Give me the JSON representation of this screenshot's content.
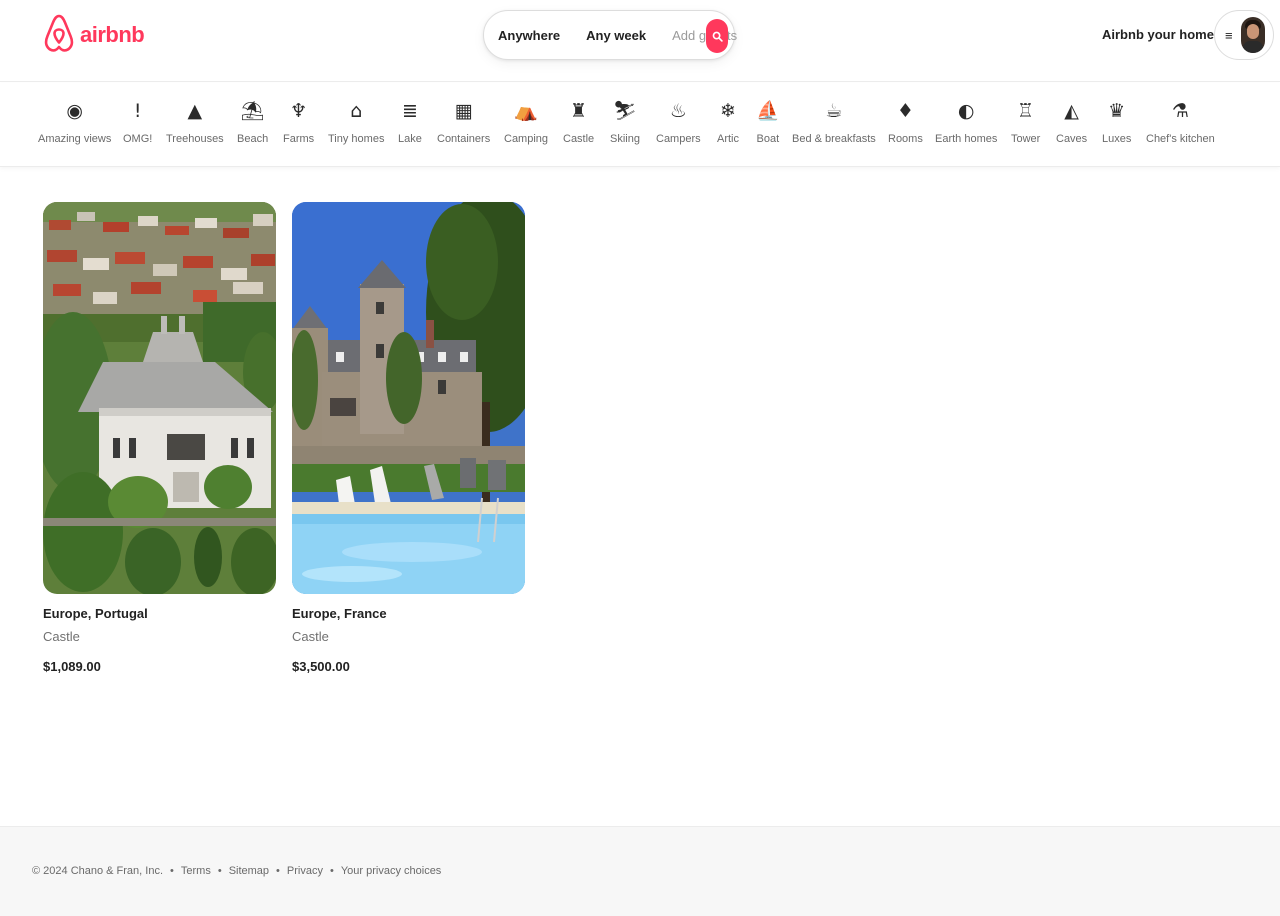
{
  "brand": {
    "name": "airbnb",
    "color": "#ff385c",
    "logo_icon": "airbnb-belo-icon"
  },
  "search": {
    "where": "Anywhere",
    "when": "Any week",
    "guests_placeholder": "Add guests",
    "button_icon": "search-icon"
  },
  "header": {
    "host_link": "Airbnb your home",
    "menu_icon": "menu-icon",
    "avatar": "user-avatar"
  },
  "categories": [
    {
      "label": "Amazing views",
      "icon": "◉"
    },
    {
      "label": "OMG!",
      "icon": "!"
    },
    {
      "label": "Treehouses",
      "icon": "▲"
    },
    {
      "label": "Beach",
      "icon": "⛱"
    },
    {
      "label": "Farms",
      "icon": "♆"
    },
    {
      "label": "Tiny homes",
      "icon": "⌂"
    },
    {
      "label": "Lake",
      "icon": "≣"
    },
    {
      "label": "Containers",
      "icon": "▦"
    },
    {
      "label": "Camping",
      "icon": "⛺"
    },
    {
      "label": "Castle",
      "icon": "♜"
    },
    {
      "label": "Skiing",
      "icon": "⛷"
    },
    {
      "label": "Campers",
      "icon": "♨"
    },
    {
      "label": "Artic",
      "icon": "❄"
    },
    {
      "label": "Boat",
      "icon": "⛵"
    },
    {
      "label": "Bed & breakfasts",
      "icon": "☕"
    },
    {
      "label": "Rooms",
      "icon": "♦"
    },
    {
      "label": "Earth homes",
      "icon": "◐"
    },
    {
      "label": "Tower",
      "icon": "♖"
    },
    {
      "label": "Caves",
      "icon": "◭"
    },
    {
      "label": "Luxes",
      "icon": "♛"
    },
    {
      "label": "Chef's kitchen",
      "icon": "⚗"
    }
  ],
  "listings": [
    {
      "title": "Europe, Portugal",
      "type": "Castle",
      "price": "$1,089.00"
    },
    {
      "title": "Europe, France",
      "type": "Castle",
      "price": "$3,500.00"
    }
  ],
  "footer": {
    "copyright": "© 2024 Chano & Fran, Inc.",
    "links": [
      "Terms",
      "Sitemap",
      "Privacy",
      "Your privacy choices"
    ]
  }
}
